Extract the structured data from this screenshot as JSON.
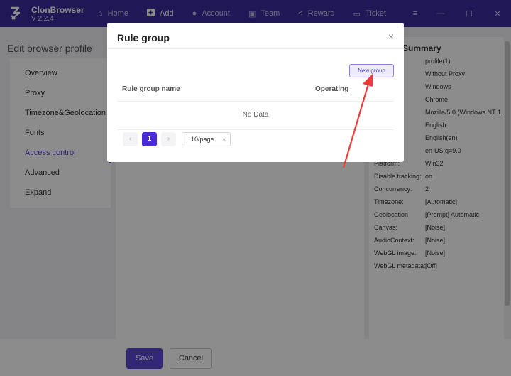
{
  "app": {
    "name": "ClonBrowser",
    "version": "V 2.2.4"
  },
  "nav": [
    {
      "label": "Home",
      "icon": "home-icon"
    },
    {
      "label": "Add",
      "icon": "plus-icon"
    },
    {
      "label": "Account",
      "icon": "account-icon"
    },
    {
      "label": "Team",
      "icon": "team-icon"
    },
    {
      "label": "Reward",
      "icon": "share-icon"
    },
    {
      "label": "Ticket",
      "icon": "ticket-icon"
    }
  ],
  "page": {
    "title": "Edit browser profile"
  },
  "sidebar": {
    "items": [
      {
        "label": "Overview"
      },
      {
        "label": "Proxy"
      },
      {
        "label": "Timezone&Geolocation"
      },
      {
        "label": "Fonts"
      },
      {
        "label": "Access control"
      },
      {
        "label": "Advanced"
      },
      {
        "label": "Expand"
      }
    ],
    "active_index": 4
  },
  "summary": {
    "title": "Summary",
    "title_visible": "Summary",
    "rows": [
      {
        "key": "e:",
        "value": "profile(1)"
      },
      {
        "key": "",
        "value": "Without Proxy"
      },
      {
        "key": "",
        "value": "Windows"
      },
      {
        "key": "",
        "value": "Chrome"
      },
      {
        "key": "t:",
        "value": "Mozilla/5.0 (Windows NT 1..."
      },
      {
        "key": "ge:",
        "value": "English"
      },
      {
        "key": "",
        "value": "English(en)"
      },
      {
        "key": "",
        "value": "en-US;q=9.0"
      },
      {
        "key": "Platform:",
        "value": "Win32"
      },
      {
        "key": "Disable tracking:",
        "value": "on"
      },
      {
        "key": "Concurrency:",
        "value": "2"
      },
      {
        "key": "Timezone:",
        "value": "[Automatic]"
      },
      {
        "key": "Geolocation",
        "value": "[Prompt] Automatic"
      },
      {
        "key": "Canvas:",
        "value": "[Noise]"
      },
      {
        "key": "AudioContext:",
        "value": "[Noise]"
      },
      {
        "key": "WebGL image:",
        "value": "[Noise]"
      },
      {
        "key": "WebGL metadata:",
        "value": "[Off]"
      }
    ]
  },
  "footer": {
    "save_label": "Save",
    "cancel_label": "Cancel"
  },
  "modal": {
    "title": "Rule group",
    "close_glyph": "×",
    "new_group_label": "New group",
    "columns": [
      "Rule group name",
      "Operating"
    ],
    "empty_text": "No Data",
    "pagination": {
      "prev": "‹",
      "current": "1",
      "next": "›",
      "page_size": "10/page"
    }
  },
  "colors": {
    "brand": "#3b2a9e",
    "accent": "#5b48d6",
    "annotation_arrow": "#f03a3a"
  }
}
